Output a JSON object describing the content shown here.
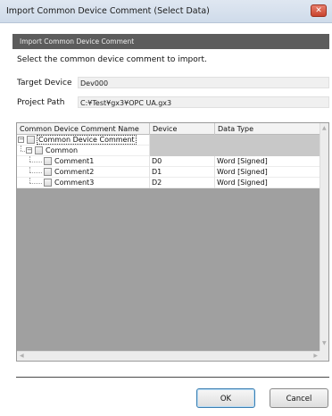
{
  "window": {
    "title": "Import Common Device Comment (Select Data)",
    "close_glyph": "✕"
  },
  "panel": {
    "header": "Import Common Device Comment",
    "instruction": "Select the common device comment to import."
  },
  "fields": {
    "target_device_label": "Target Device",
    "target_device_value": "Dev000",
    "project_path_label": "Project Path",
    "project_path_value": "C:¥Test¥gx3¥OPC UA.gx3"
  },
  "grid": {
    "columns": [
      "Common Device Comment Name",
      "Device",
      "Data Type"
    ],
    "root_label": "Common Device Comment",
    "group_label": "Common",
    "rows": [
      {
        "name": "Comment1",
        "device": "D0",
        "data_type": "Word [Signed]"
      },
      {
        "name": "Comment2",
        "device": "D1",
        "data_type": "Word [Signed]"
      },
      {
        "name": "Comment3",
        "device": "D2",
        "data_type": "Word [Signed]"
      }
    ],
    "expander_glyph": "−"
  },
  "buttons": {
    "ok": "OK",
    "cancel": "Cancel"
  },
  "colors": {
    "panel_header_bg": "#5c5c5c",
    "grid_empty_bg": "#a0a0a0",
    "close_button": "#c8432e"
  }
}
